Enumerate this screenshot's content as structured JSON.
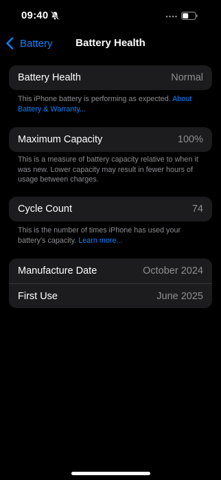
{
  "status_bar": {
    "time": "09:40",
    "icons": [
      "bell-slash-icon",
      "signal-icon",
      "battery-icon"
    ]
  },
  "nav": {
    "back_label": "Battery",
    "title": "Battery Health"
  },
  "health": {
    "label": "Battery Health",
    "value": "Normal",
    "footer_text": "This iPhone battery is performing as expected.",
    "footer_link": "About Battery & Warranty..."
  },
  "capacity": {
    "label": "Maximum Capacity",
    "value": "100%",
    "footer_text": "This is a measure of battery capacity relative to when it was new. Lower capacity may result in fewer hours of usage between charges."
  },
  "cycle": {
    "label": "Cycle Count",
    "value": "74",
    "footer_text": "This is the number of times iPhone has used your battery's capacity.",
    "footer_link": "Learn more..."
  },
  "dates": {
    "manufacture_label": "Manufacture Date",
    "manufacture_value": "October 2024",
    "first_use_label": "First Use",
    "first_use_value": "June 2025"
  },
  "colors": {
    "background": "#000000",
    "cell": "#1c1c1e",
    "accent": "#0a84ff",
    "secondary_text": "#8e8e93"
  }
}
